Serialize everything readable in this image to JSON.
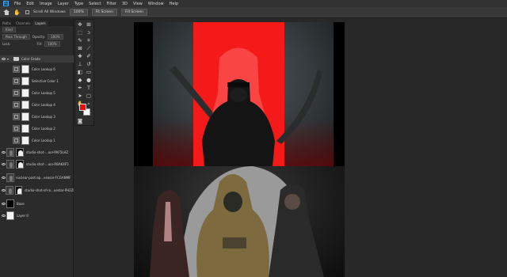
{
  "menubar": {
    "logo": "Ps",
    "items": [
      "File",
      "Edit",
      "Image",
      "Layer",
      "Type",
      "Select",
      "Filter",
      "3D",
      "View",
      "Window",
      "Help"
    ]
  },
  "options_bar": {
    "scroll_all_windows": "Scroll All Windows",
    "zoom": "100%",
    "fit_screen": "Fit Screen",
    "fill_screen": "Fill Screen"
  },
  "layers_panel": {
    "tabs": [
      "Paths",
      "Channels",
      "Layers"
    ],
    "active_tab": "Layers",
    "filter": "Kind",
    "blend_mode": "Pass Through",
    "opacity_label": "Opacity:",
    "opacity_value": "100%",
    "lock_label": "Lock:",
    "fill_label": "Fill:",
    "fill_value": "100%",
    "group_name": "Color Grade",
    "layers": [
      {
        "name": "Color Lookup 6",
        "visible": false
      },
      {
        "name": "Selective Color 1",
        "visible": false
      },
      {
        "name": "Color Lookup 5",
        "visible": false
      },
      {
        "name": "Color Lookup 4",
        "visible": false
      },
      {
        "name": "Color Lookup 3",
        "visible": false
      },
      {
        "name": "Color Lookup 2",
        "visible": false
      },
      {
        "name": "Color Lookup 1",
        "visible": false
      }
    ],
    "image_layers": [
      {
        "name": "studio-shot-...oor-PAF5LHZ",
        "visible": true
      },
      {
        "name": "studio-shot-...oor-RBAK4F5",
        "visible": true
      },
      {
        "name": "nuclear-post-ap...veasar-FCGANMF",
        "visible": true
      },
      {
        "name": "studio-shot-of-ro...uestor-PH2ZNIF",
        "visible": true
      },
      {
        "name": "Base",
        "visible": true
      },
      {
        "name": "Layer 0",
        "visible": true
      }
    ]
  },
  "colors": {
    "foreground": "#ff0000",
    "background": "#ffffff",
    "accent": "#31a8ff"
  }
}
